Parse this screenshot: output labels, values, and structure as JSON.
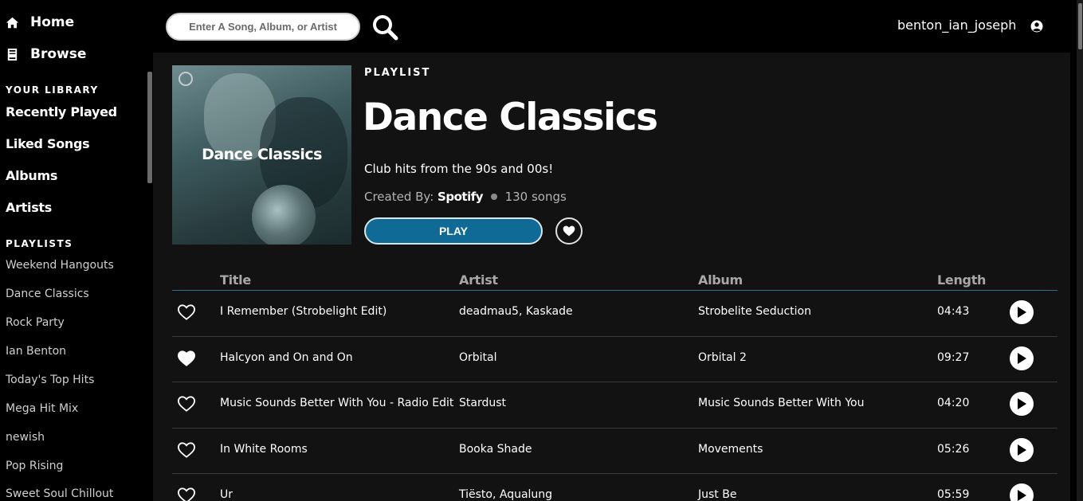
{
  "sidebar": {
    "nav": [
      {
        "label": "Home",
        "icon": "home-icon"
      },
      {
        "label": "Browse",
        "icon": "book-icon"
      }
    ],
    "library_heading": "YOUR LIBRARY",
    "library": [
      "Recently Played",
      "Liked Songs",
      "Albums",
      "Artists"
    ],
    "playlists_heading": "PLAYLISTS",
    "playlists": [
      "Weekend Hangouts",
      "Dance Classics",
      "Rock Party",
      "Ian Benton",
      "Today's Top Hits",
      "Mega Hit Mix",
      "newish",
      "Pop Rising",
      "Sweet Soul Chillout"
    ]
  },
  "topbar": {
    "search_placeholder": "Enter A Song, Album, or Artist",
    "username": "benton_ian_joseph"
  },
  "playlist": {
    "type_label": "PLAYLIST",
    "cover_title": "Dance Classics",
    "title": "Dance Classics",
    "description": "Club hits from the 90s and 00s!",
    "created_by_label": "Created By:",
    "owner": "Spotify",
    "song_count": "130 songs",
    "play_label": "PLAY"
  },
  "table": {
    "headers": [
      "Title",
      "Artist",
      "Album",
      "Length"
    ],
    "rows": [
      {
        "title": "I Remember (Strobelight Edit)",
        "artist": "deadmau5,  Kaskade",
        "album": "Strobelite Seduction",
        "length": "04:43",
        "liked": false
      },
      {
        "title": "Halcyon and On and On",
        "artist": "Orbital",
        "album": "Orbital 2",
        "length": "09:27",
        "liked": true
      },
      {
        "title": "Music Sounds Better With You - Radio Edit",
        "artist": "Stardust",
        "album": "Music Sounds Better With You",
        "length": "04:20",
        "liked": false
      },
      {
        "title": "In White Rooms",
        "artist": "Booka Shade",
        "album": "Movements",
        "length": "05:26",
        "liked": false
      },
      {
        "title": "Ur",
        "artist": "Tiësto,  Aqualung",
        "album": "Just Be",
        "length": "05:59",
        "liked": false
      }
    ]
  },
  "colors": {
    "accent": "#0f6a96",
    "background": "#000000",
    "content_bg": "#121212"
  }
}
